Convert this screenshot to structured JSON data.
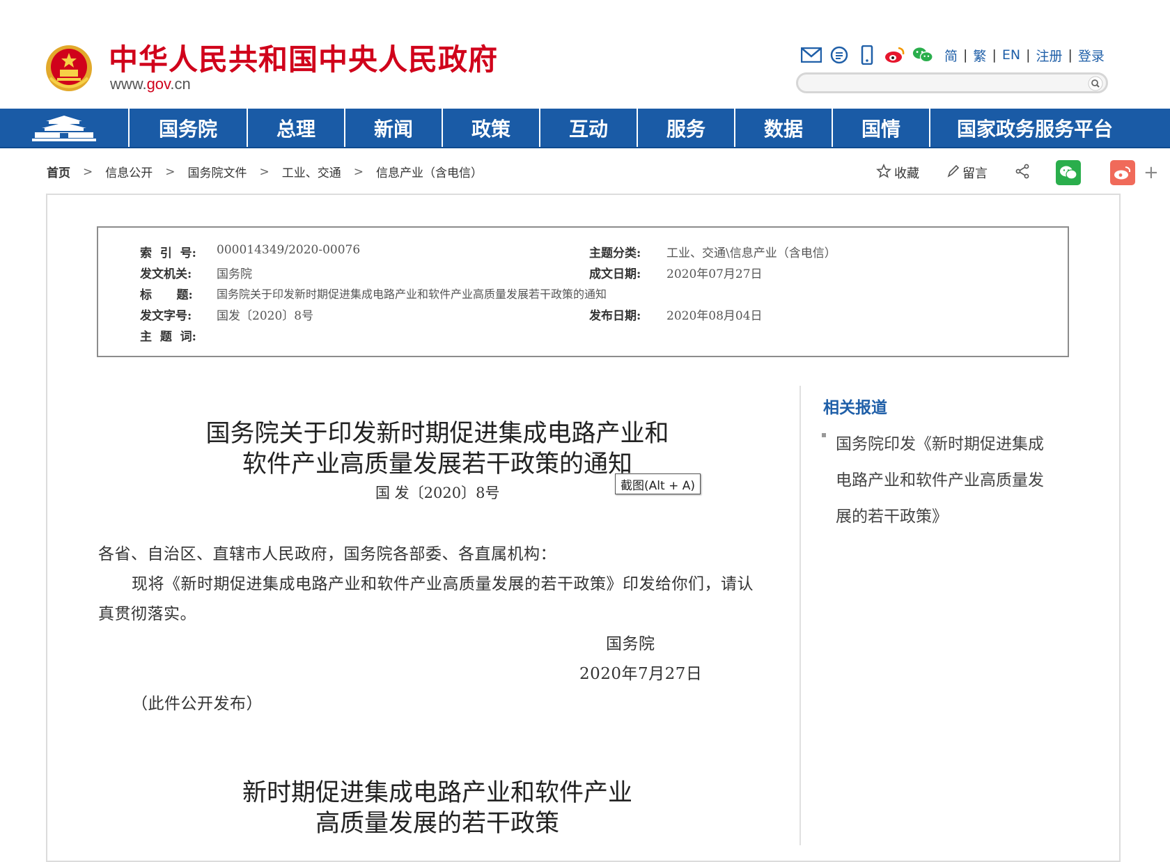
{
  "header": {
    "site_title": "中华人民共和国中央人民政府",
    "url_prefix": "www.",
    "url_domain": "gov",
    "url_suffix": ".cn",
    "icons": [
      "mail-icon",
      "message-icon",
      "mobile-icon",
      "weibo-icon",
      "wechat-icon"
    ],
    "lang_links": [
      "简",
      "繁",
      "EN",
      "注册",
      "登录"
    ],
    "search_placeholder": ""
  },
  "nav": {
    "items": [
      "国务院",
      "总理",
      "新闻",
      "政策",
      "互动",
      "服务",
      "数据",
      "国情",
      "国家政务服务平台"
    ]
  },
  "breadcrumb": [
    "首页",
    "信息公开",
    "国务院文件",
    "工业、交通",
    "信息产业（含电信）"
  ],
  "share": {
    "favorite": "收藏",
    "comment": "留言",
    "plus": "+"
  },
  "meta": {
    "index_label": "索  引  号:",
    "index_value": "000014349/2020-00076",
    "topic_label": "主题分类:",
    "topic_value": "工业、交通\\信息产业（含电信）",
    "issuer_label": "发文机关:",
    "issuer_value": "国务院",
    "date_written_label": "成文日期:",
    "date_written_value": "2020年07月27日",
    "title_label": "标      题:",
    "title_value": "国务院关于印发新时期促进集成电路产业和软件产业高质量发展若干政策的通知",
    "doc_no_label": "发文字号:",
    "doc_no_value": "国发〔2020〕8号",
    "publish_label": "发布日期:",
    "publish_value": "2020年08月04日",
    "keywords_label": "主  题  词:"
  },
  "article": {
    "title_line1": "国务院关于印发新时期促进集成电路产业和",
    "title_line2": "软件产业高质量发展若干政策的通知",
    "doc_number": "国 发〔2020〕8号",
    "tooltip": "截图(Alt + A)",
    "salutation": "各省、自治区、直辖市人民政府，国务院各部委、各直属机构：",
    "para1_line1": "现将《新时期促进集成电路产业和软件产业高质量发展的若干政策》印发给你们，请认",
    "para1_line2": "真贯彻落实。",
    "signer": "国务院",
    "sign_date": "2020年7月27日",
    "public_note": "（此件公开发布）",
    "policy_title_line1": "新时期促进集成电路产业和软件产业",
    "policy_title_line2": "高质量发展的若干政策"
  },
  "sidebar": {
    "title": "相关报道",
    "item_line1": "国务院印发《新时期促进集成",
    "item_line2": "电路产业和软件产业高质量发",
    "item_line3": "展的若干政策》"
  },
  "colors": {
    "brand_red": "#d0021b",
    "nav_blue": "#1a5ba6",
    "link_blue": "#1f5fa8",
    "wechat_green": "#2aae4c",
    "weibo_red": "#f06a5a"
  }
}
